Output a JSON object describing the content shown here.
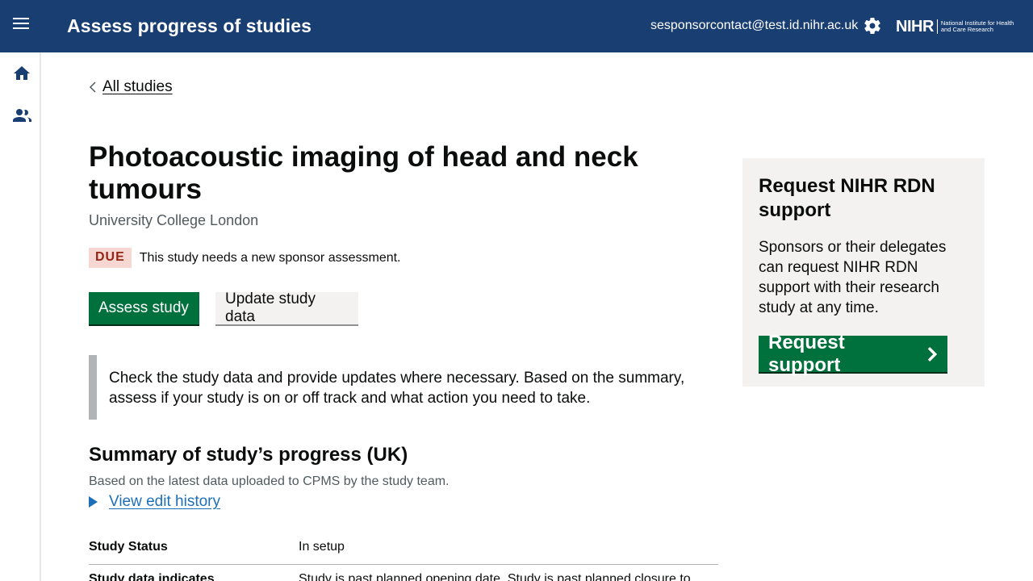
{
  "header": {
    "app_title": "Assess progress of studies",
    "user_email": "sesponsorcontact@test.id.nihr.ac.uk",
    "logo_mark": "NIHR",
    "logo_text": "National Institute for Health and Care Research"
  },
  "sidebar": {
    "items": [
      {
        "icon": "home-icon"
      },
      {
        "icon": "people-icon"
      }
    ]
  },
  "breadcrumb": {
    "back_label": "All studies"
  },
  "study": {
    "title": "Photoacoustic imaging of head and neck tumours",
    "organisation": "University College London",
    "status_tag": "DUE",
    "status_message": "This study needs a new sponsor assessment."
  },
  "actions": {
    "assess_label": "Assess study",
    "update_label": "Update study data"
  },
  "inset_text": "Check the study data and provide updates where necessary. Based on the summary, assess if your study is on or off track and what action you need to take.",
  "summary": {
    "title": "Summary of study’s progress (UK)",
    "subtitle": "Based on the latest data uploaded to CPMS by the study team.",
    "history_link": "View edit history",
    "rows": [
      {
        "key": "Study Status",
        "value": "In setup"
      },
      {
        "key": "Study data indicates",
        "value": "Study is past planned opening date. Study is past planned closure to"
      }
    ]
  },
  "support_panel": {
    "title": "Request NIHR RDN support",
    "text": "Sponsors or their delegates can request NIHR RDN support with their research study at any time.",
    "button_label": "Request support"
  },
  "colors": {
    "header_bg": "#193e72",
    "primary_green": "#00703c",
    "link_blue": "#1d70b8",
    "due_bg": "#f6d7d2",
    "due_fg": "#942514"
  }
}
